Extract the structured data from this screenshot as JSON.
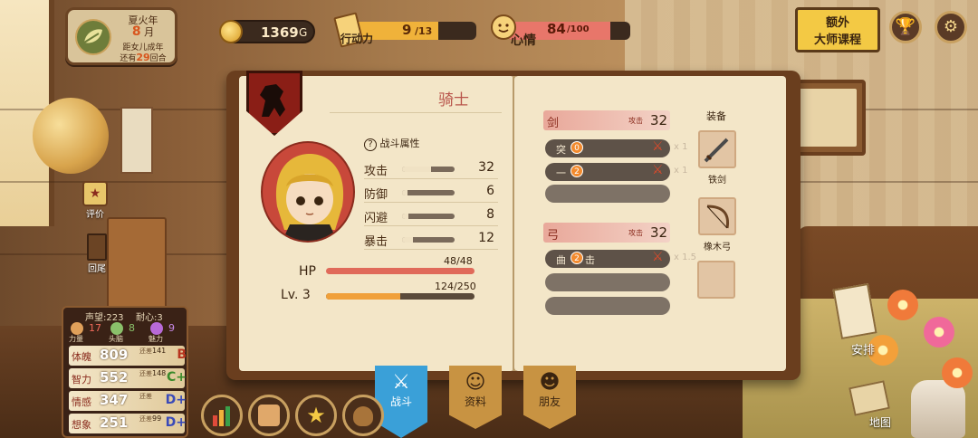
{
  "hud": {
    "season": "夏火年",
    "month_num": "8",
    "month_unit": "月",
    "countdown_prefix": "距女儿成年",
    "countdown_mid": "还有",
    "countdown_num": "29",
    "countdown_suffix": "回合",
    "gold": "1369",
    "gold_unit": "G",
    "action_label": "行动力",
    "action_value": "9",
    "action_max": "/13",
    "action_fraction": 0.69,
    "mood_label": "心情",
    "mood_value": "84",
    "mood_max": "/100",
    "mood_fraction": 0.84,
    "course_line1": "额外",
    "course_line2": "大师课程",
    "colors": {
      "gold": "#d89a22",
      "action": "#f0b23a",
      "mood": "#e8766a"
    }
  },
  "side_buttons": {
    "review_label": "评价",
    "back_label": "回尾"
  },
  "book": {
    "class_name": "骑士",
    "combat_title": "战斗属性",
    "combat_help": "?",
    "stats": [
      {
        "label": "攻击",
        "value": "32",
        "fraction": 0.55
      },
      {
        "label": "防御",
        "value": "6",
        "fraction": 0.1
      },
      {
        "label": "闪避",
        "value": "8",
        "fraction": 0.12
      },
      {
        "label": "暴击",
        "value": "12",
        "fraction": 0.2
      }
    ],
    "hp_label": "HP",
    "hp_value": "48/48",
    "hp_fraction": 1.0,
    "lv_label": "Lv. 3",
    "exp_value": "124/250",
    "exp_fraction": 0.5,
    "sword": {
      "label": "剑",
      "attack_label": "攻击",
      "value": "32",
      "skills": [
        {
          "name": "突",
          "badge": "0",
          "mult": "x 1"
        },
        {
          "name": "一",
          "badge": "2",
          "mult": "x 1"
        }
      ]
    },
    "bow": {
      "label": "弓",
      "attack_label": "攻击",
      "value": "32",
      "skills": [
        {
          "name": "曲",
          "badge": "2",
          "suffix": "击",
          "mult": "x 1.5"
        }
      ]
    },
    "equip_title": "装备",
    "equip": [
      {
        "name": "铁剑",
        "icon": "iron-sword-icon"
      },
      {
        "name": "橡木弓",
        "icon": "oak-bow-icon"
      }
    ]
  },
  "bottom_tabs": [
    {
      "label": "战斗",
      "icon": "crossed-swords-icon",
      "active": true
    },
    {
      "label": "资料",
      "icon": "girl-face-icon",
      "active": false
    },
    {
      "label": "朋友",
      "icon": "friend-icon",
      "active": false
    }
  ],
  "attributes": {
    "reputation": "声望:223",
    "patience": "耐心:3",
    "stats": [
      {
        "label": "力量",
        "value": "17"
      },
      {
        "label": "头脑",
        "value": "8"
      },
      {
        "label": "魅力",
        "value": "9"
      }
    ],
    "rows": [
      {
        "label": "体魄",
        "value": "809",
        "hint": "还差",
        "need": "141",
        "grade": "B",
        "grade_color": "#b8341e"
      },
      {
        "label": "智力",
        "value": "552",
        "hint": "还差",
        "need": "148",
        "grade": "C+",
        "grade_color": "#3a8a2a"
      },
      {
        "label": "情感",
        "value": "347",
        "hint": "还差",
        "need": "",
        "grade": "D+",
        "grade_color": "#3a4ab8"
      },
      {
        "label": "想象",
        "value": "251",
        "hint": "还差",
        "need": "99",
        "grade": "D+",
        "grade_color": "#3a4ab8"
      }
    ]
  },
  "right_actions": {
    "arrange_label": "安排",
    "map_label": "地图"
  }
}
